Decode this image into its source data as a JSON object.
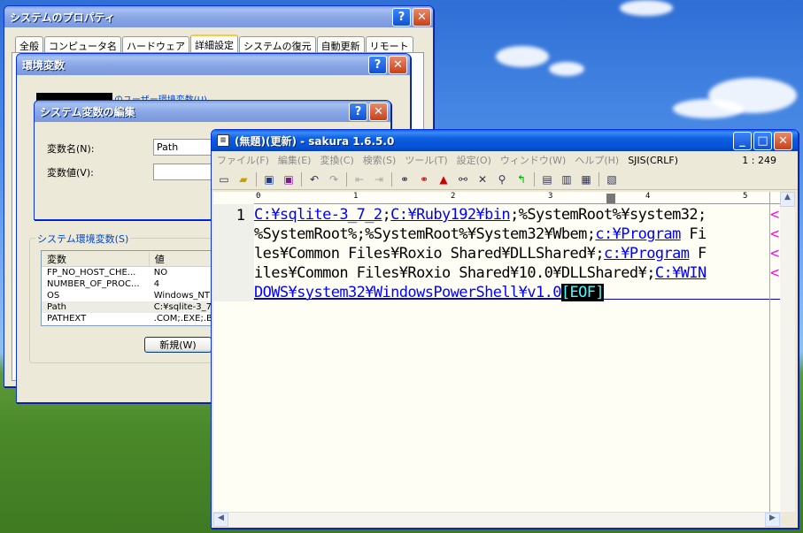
{
  "sysprops": {
    "title": "システムのプロパティ",
    "help_glyph": "?",
    "close_glyph": "✕",
    "tabs": [
      "全般",
      "コンピュータ名",
      "ハードウェア",
      "詳細設定",
      "システムの復元",
      "自動更新",
      "リモート"
    ]
  },
  "envvars": {
    "title": "環境変数",
    "user_group_label": "のユーザー環境変数(U)",
    "system_group_label": "システム環境変数(S)",
    "col_variable": "変数",
    "col_value": "値",
    "rows": [
      {
        "name": "FP_NO_HOST_CHE...",
        "value": "NO"
      },
      {
        "name": "NUMBER_OF_PROC...",
        "value": "4"
      },
      {
        "name": "OS",
        "value": "Windows_NT"
      },
      {
        "name": "Path",
        "value": "C:¥sqlite-3_7_"
      },
      {
        "name": "PATHEXT",
        "value": ".COM;.EXE;.BA"
      }
    ],
    "new_button": "新規(W)"
  },
  "editvar": {
    "title": "システム変数の編集",
    "name_label": "変数名(N):",
    "name_value": "Path",
    "value_label": "変数値(V):",
    "value_value": ""
  },
  "sakura": {
    "title": "(無題)(更新) - sakura 1.6.5.0",
    "menu": [
      "ファイル(F)",
      "編集(E)",
      "変換(C)",
      "検索(S)",
      "ツール(T)",
      "設定(O)",
      "ウィンドウ(W)",
      "ヘルプ(H)"
    ],
    "encoding": "SJIS(CRLF)",
    "cursor_pos": "1 : 249",
    "line_number": "1",
    "ruler_marks": [
      "0",
      "1",
      "2",
      "3",
      "4",
      "5"
    ],
    "lines": [
      [
        {
          "t": "C:¥sqlite-3_7_2",
          "u": true
        },
        {
          "t": ";",
          "u": false
        },
        {
          "t": "C:¥Ruby192¥bin",
          "u": true
        },
        {
          "t": ";%SystemRoot%¥system32;",
          "u": false
        }
      ],
      [
        {
          "t": "%SystemRoot%;%SystemRoot%¥System32¥Wbem;",
          "u": false
        },
        {
          "t": "c:¥Program",
          "u": true
        },
        {
          "t": " Fi",
          "u": false
        }
      ],
      [
        {
          "t": "les¥Common Files¥Roxio Shared¥DLLShared¥;",
          "u": false
        },
        {
          "t": "c:¥Program",
          "u": true
        },
        {
          "t": " F",
          "u": false
        }
      ],
      [
        {
          "t": "iles¥Common Files¥Roxio Shared¥10.0¥DLLShared¥;",
          "u": false
        },
        {
          "t": "C:¥WIN",
          "u": true
        }
      ],
      [
        {
          "t": "DOWS¥system32¥WindowsPowerShell¥v1.0",
          "u": true
        }
      ]
    ],
    "eof": "[EOF]",
    "wrap_glyph": "<",
    "min_glyph": "_",
    "max_glyph": "□",
    "close_glyph": "✕",
    "toolbar_icons": [
      "new-icon",
      "open-icon",
      "save-icon",
      "save-all-icon",
      "undo-icon",
      "redo-icon",
      "back-icon",
      "forward-icon",
      "find-icon",
      "find-next-icon",
      "find-prev-icon",
      "replace-icon",
      "grep-icon",
      "bookmark-icon",
      "jump-icon",
      "outline-icon",
      "type-icon",
      "settings-icon",
      "font-icon"
    ]
  }
}
